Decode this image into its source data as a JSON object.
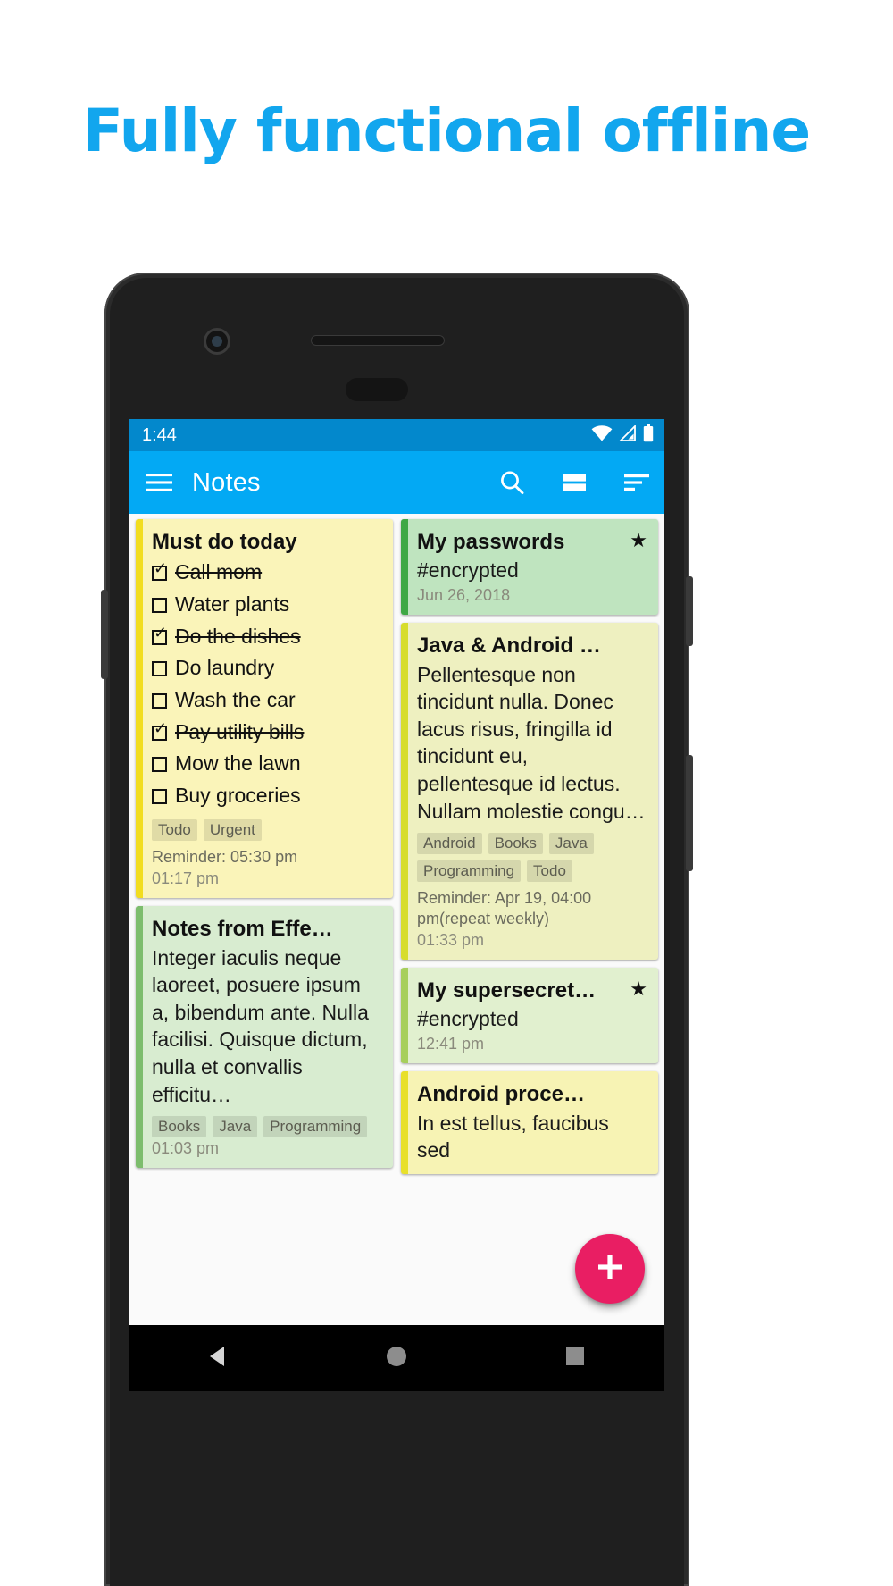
{
  "headline": "Fully functional offline",
  "colors": {
    "headline": "#12a6ee",
    "status_bar": "#0388cc",
    "app_bar": "#03a9f4",
    "fab": "#e91e63",
    "card_yellow": "#faf4b9",
    "card_yellow_accent": "#f2dd1f",
    "card_green": "#bfe4bf",
    "card_green_accent": "#3fa845",
    "card_lightgreen": "#d8ecd0",
    "card_lightgreen_accent": "#7dbd6d",
    "card_olive": "#eef0c0",
    "card_olive_accent": "#d7dd2c"
  },
  "status_bar": {
    "time": "1:44",
    "icons": [
      "wifi-icon",
      "signal-icon",
      "battery-icon"
    ]
  },
  "app_bar": {
    "menu_icon": "hamburger-menu-icon",
    "title": "Notes",
    "actions": [
      {
        "name": "search-icon",
        "label": "Search"
      },
      {
        "name": "layout-toggle-icon",
        "label": "Change layout"
      },
      {
        "name": "sort-icon",
        "label": "Sort"
      }
    ]
  },
  "fab": {
    "icon": "plus-icon",
    "label": "Add note"
  },
  "nav_bar": {
    "back": "back-triangle-icon",
    "home": "home-circle-icon",
    "recents": "recents-square-icon"
  },
  "notes": {
    "left": [
      {
        "id": "must-do-today",
        "title": "Must do today",
        "color": "yellow",
        "starred": false,
        "checklist": [
          {
            "text": "Call mom",
            "checked": true
          },
          {
            "text": "Water plants",
            "checked": false
          },
          {
            "text": "Do the dishes",
            "checked": true
          },
          {
            "text": "Do laundry",
            "checked": false
          },
          {
            "text": "Wash the car",
            "checked": false
          },
          {
            "text": "Pay utility bills",
            "checked": true
          },
          {
            "text": "Mow the lawn",
            "checked": false
          },
          {
            "text": "Buy groceries",
            "checked": false
          }
        ],
        "tags": [
          "Todo",
          "Urgent"
        ],
        "reminder": "Reminder: 05:30 pm",
        "date": "01:17 pm"
      },
      {
        "id": "notes-from-effective-java",
        "title": "Notes from Effe…",
        "color": "lightgreen",
        "starred": false,
        "body": "Integer iaculis neque laoreet, posuere ipsum a, bibendum ante. Nulla facilisi. Quisque dictum, nulla et convallis efficitu…",
        "tags": [
          "Books",
          "Java",
          "Programming"
        ],
        "reminder": "",
        "date": "01:03 pm"
      }
    ],
    "right": [
      {
        "id": "my-passwords",
        "title": "My passwords",
        "color": "green",
        "starred": true,
        "sub": "#encrypted",
        "date": "Jun 26, 2018"
      },
      {
        "id": "java-and-android",
        "title": "Java & Android …",
        "color": "olive",
        "starred": false,
        "body": "Pellentesque non tincidunt nulla. Donec lacus risus, fringilla id tincidunt eu, pellentesque id lectus. Nullam molestie congu…",
        "tags": [
          "Android",
          "Books",
          "Java",
          "Programming",
          "Todo"
        ],
        "reminder": "Reminder: Apr 19, 04:00 pm(repeat weekly)",
        "date": "01:33 pm"
      },
      {
        "id": "my-supersecret",
        "title": "My supersecret…",
        "color": "lightgreen",
        "starred": true,
        "sub": "#encrypted",
        "date": "12:41 pm"
      },
      {
        "id": "android-process",
        "title": "Android proce…",
        "color": "olive",
        "starred": false,
        "body": "In est tellus, faucibus sed"
      }
    ]
  }
}
